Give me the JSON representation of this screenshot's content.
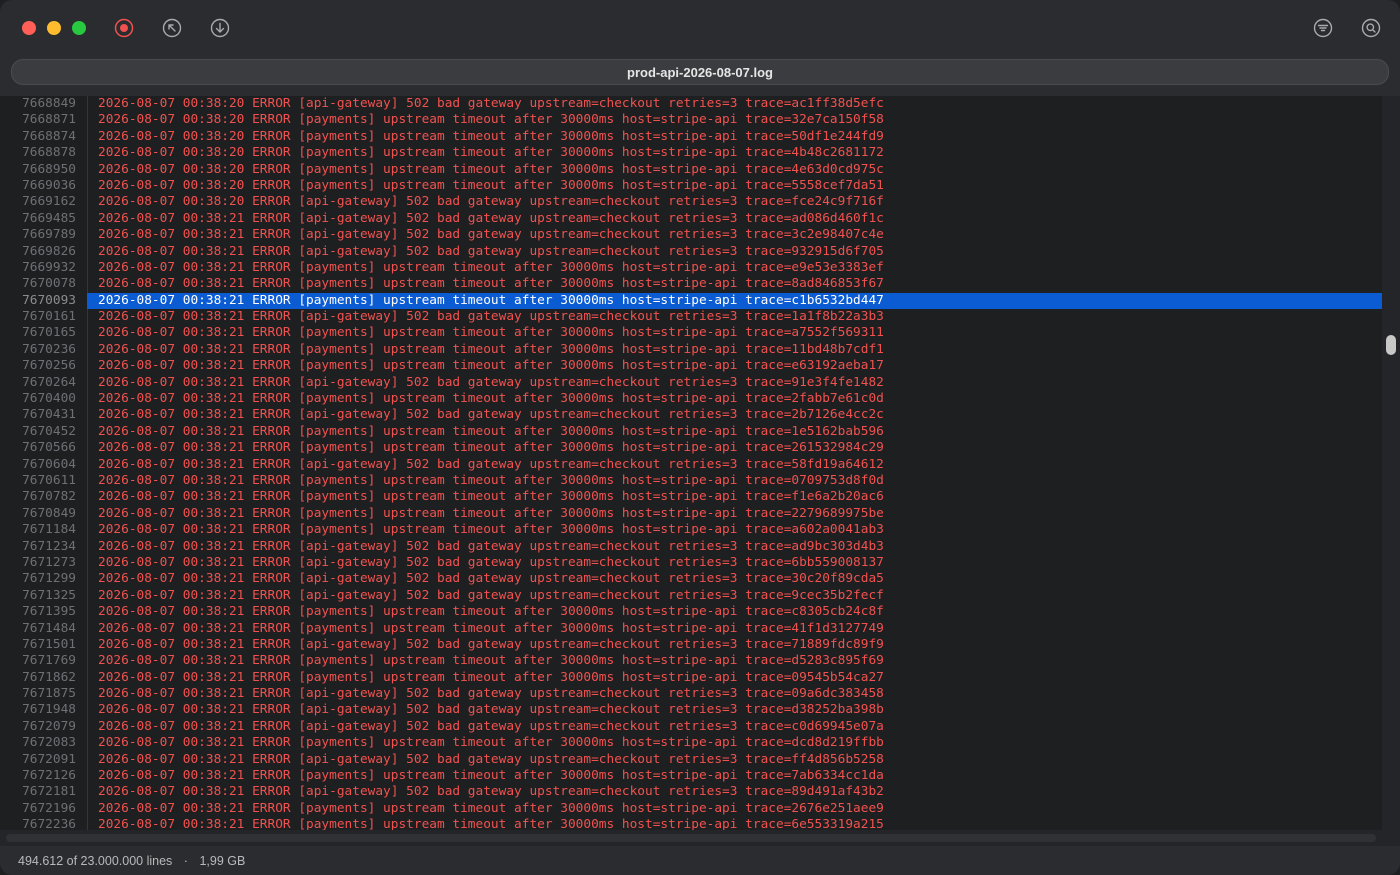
{
  "window": {
    "filename": "prod-api-2026-08-07.log"
  },
  "toolbar": {
    "record_icon": "record-icon",
    "jump_top_icon": "jump-to-top-icon",
    "jump_bottom_icon": "jump-to-bottom-icon",
    "filter_icon": "filter-icon",
    "search_icon": "search-icon"
  },
  "status": {
    "lines": "494.612 of 23.000.000 lines",
    "separator": "·",
    "size": "1,99 GB"
  },
  "colors": {
    "error_text": "#f0524f",
    "selection": "#0b5bd3",
    "line_number": "#6e7075"
  },
  "selected_index": 12,
  "log_lines": [
    {
      "n": "7668849",
      "t": "2026-08-07 00:38:20 ERROR [api-gateway] 502 bad gateway upstream=checkout retries=3 trace=ac1ff38d5efc"
    },
    {
      "n": "7668871",
      "t": "2026-08-07 00:38:20 ERROR [payments] upstream timeout after 30000ms host=stripe-api trace=32e7ca150f58"
    },
    {
      "n": "7668874",
      "t": "2026-08-07 00:38:20 ERROR [payments] upstream timeout after 30000ms host=stripe-api trace=50df1e244fd9"
    },
    {
      "n": "7668878",
      "t": "2026-08-07 00:38:20 ERROR [payments] upstream timeout after 30000ms host=stripe-api trace=4b48c2681172"
    },
    {
      "n": "7668950",
      "t": "2026-08-07 00:38:20 ERROR [payments] upstream timeout after 30000ms host=stripe-api trace=4e63d0cd975c"
    },
    {
      "n": "7669036",
      "t": "2026-08-07 00:38:20 ERROR [payments] upstream timeout after 30000ms host=stripe-api trace=5558cef7da51"
    },
    {
      "n": "7669162",
      "t": "2026-08-07 00:38:20 ERROR [api-gateway] 502 bad gateway upstream=checkout retries=3 trace=fce24c9f716f"
    },
    {
      "n": "7669485",
      "t": "2026-08-07 00:38:21 ERROR [api-gateway] 502 bad gateway upstream=checkout retries=3 trace=ad086d460f1c"
    },
    {
      "n": "7669789",
      "t": "2026-08-07 00:38:21 ERROR [api-gateway] 502 bad gateway upstream=checkout retries=3 trace=3c2e98407c4e"
    },
    {
      "n": "7669826",
      "t": "2026-08-07 00:38:21 ERROR [api-gateway] 502 bad gateway upstream=checkout retries=3 trace=932915d6f705"
    },
    {
      "n": "7669932",
      "t": "2026-08-07 00:38:21 ERROR [payments] upstream timeout after 30000ms host=stripe-api trace=e9e53e3383ef"
    },
    {
      "n": "7670078",
      "t": "2026-08-07 00:38:21 ERROR [payments] upstream timeout after 30000ms host=stripe-api trace=8ad846853f67"
    },
    {
      "n": "7670093",
      "t": "2026-08-07 00:38:21 ERROR [payments] upstream timeout after 30000ms host=stripe-api trace=c1b6532bd447"
    },
    {
      "n": "7670161",
      "t": "2026-08-07 00:38:21 ERROR [api-gateway] 502 bad gateway upstream=checkout retries=3 trace=1a1f8b22a3b3"
    },
    {
      "n": "7670165",
      "t": "2026-08-07 00:38:21 ERROR [payments] upstream timeout after 30000ms host=stripe-api trace=a7552f569311"
    },
    {
      "n": "7670236",
      "t": "2026-08-07 00:38:21 ERROR [payments] upstream timeout after 30000ms host=stripe-api trace=11bd48b7cdf1"
    },
    {
      "n": "7670256",
      "t": "2026-08-07 00:38:21 ERROR [payments] upstream timeout after 30000ms host=stripe-api trace=e63192aeba17"
    },
    {
      "n": "7670264",
      "t": "2026-08-07 00:38:21 ERROR [api-gateway] 502 bad gateway upstream=checkout retries=3 trace=91e3f4fe1482"
    },
    {
      "n": "7670400",
      "t": "2026-08-07 00:38:21 ERROR [payments] upstream timeout after 30000ms host=stripe-api trace=2fabb7e61c0d"
    },
    {
      "n": "7670431",
      "t": "2026-08-07 00:38:21 ERROR [api-gateway] 502 bad gateway upstream=checkout retries=3 trace=2b7126e4cc2c"
    },
    {
      "n": "7670452",
      "t": "2026-08-07 00:38:21 ERROR [payments] upstream timeout after 30000ms host=stripe-api trace=1e5162bab596"
    },
    {
      "n": "7670566",
      "t": "2026-08-07 00:38:21 ERROR [payments] upstream timeout after 30000ms host=stripe-api trace=261532984c29"
    },
    {
      "n": "7670604",
      "t": "2026-08-07 00:38:21 ERROR [api-gateway] 502 bad gateway upstream=checkout retries=3 trace=58fd19a64612"
    },
    {
      "n": "7670611",
      "t": "2026-08-07 00:38:21 ERROR [payments] upstream timeout after 30000ms host=stripe-api trace=0709753d8f0d"
    },
    {
      "n": "7670782",
      "t": "2026-08-07 00:38:21 ERROR [payments] upstream timeout after 30000ms host=stripe-api trace=f1e6a2b20ac6"
    },
    {
      "n": "7670849",
      "t": "2026-08-07 00:38:21 ERROR [payments] upstream timeout after 30000ms host=stripe-api trace=2279689975be"
    },
    {
      "n": "7671184",
      "t": "2026-08-07 00:38:21 ERROR [payments] upstream timeout after 30000ms host=stripe-api trace=a602a0041ab3"
    },
    {
      "n": "7671234",
      "t": "2026-08-07 00:38:21 ERROR [api-gateway] 502 bad gateway upstream=checkout retries=3 trace=ad9bc303d4b3"
    },
    {
      "n": "7671273",
      "t": "2026-08-07 00:38:21 ERROR [api-gateway] 502 bad gateway upstream=checkout retries=3 trace=6bb559008137"
    },
    {
      "n": "7671299",
      "t": "2026-08-07 00:38:21 ERROR [api-gateway] 502 bad gateway upstream=checkout retries=3 trace=30c20f89cda5"
    },
    {
      "n": "7671325",
      "t": "2026-08-07 00:38:21 ERROR [api-gateway] 502 bad gateway upstream=checkout retries=3 trace=9cec35b2fecf"
    },
    {
      "n": "7671395",
      "t": "2026-08-07 00:38:21 ERROR [payments] upstream timeout after 30000ms host=stripe-api trace=c8305cb24c8f"
    },
    {
      "n": "7671484",
      "t": "2026-08-07 00:38:21 ERROR [payments] upstream timeout after 30000ms host=stripe-api trace=41f1d3127749"
    },
    {
      "n": "7671501",
      "t": "2026-08-07 00:38:21 ERROR [api-gateway] 502 bad gateway upstream=checkout retries=3 trace=71889fdc89f9"
    },
    {
      "n": "7671769",
      "t": "2026-08-07 00:38:21 ERROR [payments] upstream timeout after 30000ms host=stripe-api trace=d5283c895f69"
    },
    {
      "n": "7671862",
      "t": "2026-08-07 00:38:21 ERROR [payments] upstream timeout after 30000ms host=stripe-api trace=09545b54ca27"
    },
    {
      "n": "7671875",
      "t": "2026-08-07 00:38:21 ERROR [api-gateway] 502 bad gateway upstream=checkout retries=3 trace=09a6dc383458"
    },
    {
      "n": "7671948",
      "t": "2026-08-07 00:38:21 ERROR [api-gateway] 502 bad gateway upstream=checkout retries=3 trace=d38252ba398b"
    },
    {
      "n": "7672079",
      "t": "2026-08-07 00:38:21 ERROR [api-gateway] 502 bad gateway upstream=checkout retries=3 trace=c0d69945e07a"
    },
    {
      "n": "7672083",
      "t": "2026-08-07 00:38:21 ERROR [payments] upstream timeout after 30000ms host=stripe-api trace=dcd8d219ffbb"
    },
    {
      "n": "7672091",
      "t": "2026-08-07 00:38:21 ERROR [api-gateway] 502 bad gateway upstream=checkout retries=3 trace=ff4d856b5258"
    },
    {
      "n": "7672126",
      "t": "2026-08-07 00:38:21 ERROR [payments] upstream timeout after 30000ms host=stripe-api trace=7ab6334cc1da"
    },
    {
      "n": "7672181",
      "t": "2026-08-07 00:38:21 ERROR [api-gateway] 502 bad gateway upstream=checkout retries=3 trace=89d491af43b2"
    },
    {
      "n": "7672196",
      "t": "2026-08-07 00:38:21 ERROR [payments] upstream timeout after 30000ms host=stripe-api trace=2676e251aee9"
    },
    {
      "n": "7672236",
      "t": "2026-08-07 00:38:21 ERROR [payments] upstream timeout after 30000ms host=stripe-api trace=6e553319a215"
    }
  ]
}
